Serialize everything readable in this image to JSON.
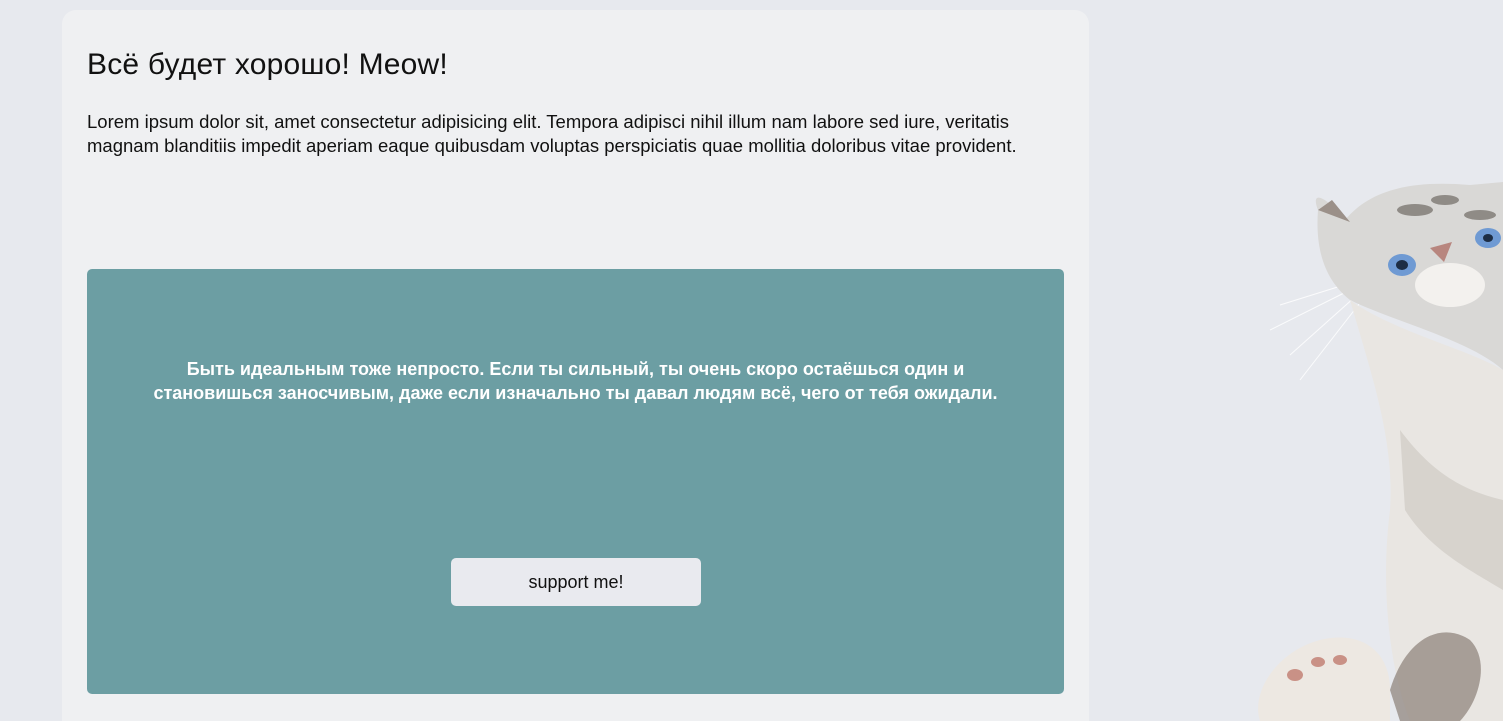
{
  "card": {
    "title": "Всё будет хорошо! Meow!",
    "lead": "Lorem ipsum dolor sit, amet consectetur adipisicing elit. Tempora adipisci nihil illum nam labore sed iure, veritatis magnam blanditiis impedit aperiam eaque quibusdam voluptas perspiciatis quae mollitia doloribus vitae provident."
  },
  "quote_box": {
    "text": "Быть идеальным тоже непросто. Если ты сильный, ты очень скоро остаёшься один и становишься заносчивым, даже если изначально ты давал людям всё, чего от тебя ожидали.",
    "button_label": "support me!"
  },
  "colors": {
    "page_bg": "#e7e9ee",
    "card_bg": "#eff0f2",
    "quote_bg": "#6c9ea3",
    "button_bg": "#e9eaef"
  }
}
